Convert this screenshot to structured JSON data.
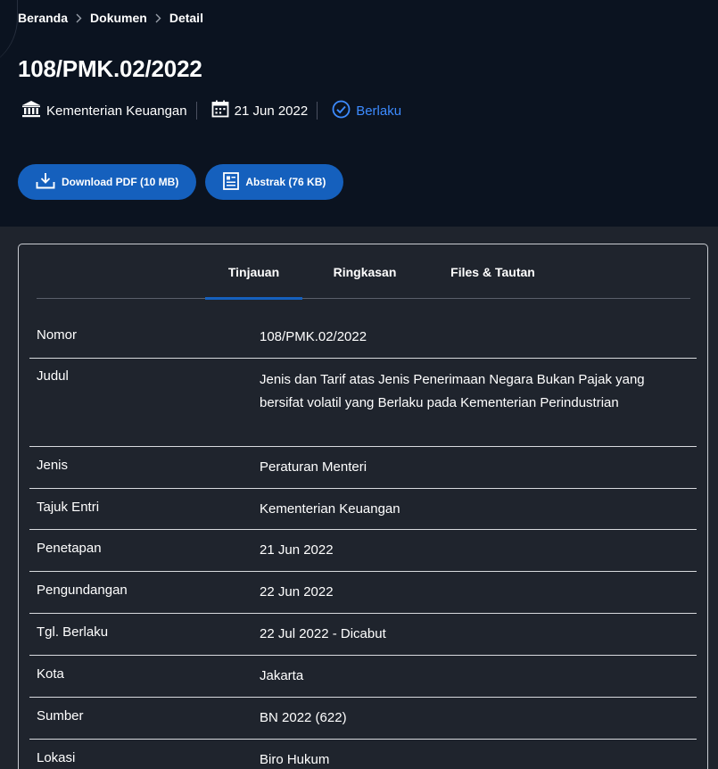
{
  "breadcrumb": [
    "Beranda",
    "Dokumen",
    "Detail"
  ],
  "title": "108/PMK.02/2022",
  "meta": {
    "institution": "Kementerian Keuangan",
    "date": "21 Jun 2022",
    "status": "Berlaku"
  },
  "buttons": {
    "download": "Download PDF (10 MB)",
    "abstract": "Abstrak (76 KB)"
  },
  "tabs": [
    "Tinjauan",
    "Ringkasan",
    "Files & Tautan"
  ],
  "active_tab": "Tinjauan",
  "rows": [
    {
      "label": "Nomor",
      "value": "108/PMK.02/2022"
    },
    {
      "label": "Judul",
      "value": "Jenis dan Tarif atas Jenis Penerimaan Negara Bukan Pajak yang bersifat volatil yang Berlaku pada Kementerian Perindustrian"
    },
    {
      "label": "Jenis",
      "value": "Peraturan Menteri"
    },
    {
      "label": "Tajuk Entri",
      "value": "Kementerian Keuangan"
    },
    {
      "label": "Penetapan",
      "value": "21 Jun 2022"
    },
    {
      "label": "Pengundangan",
      "value": "22 Jun 2022"
    },
    {
      "label": "Tgl. Berlaku",
      "value": "22 Jul 2022 - Dicabut"
    },
    {
      "label": "Kota",
      "value": "Jakarta"
    },
    {
      "label": "Sumber",
      "value": "BN 2022 (622)"
    },
    {
      "label": "Lokasi",
      "value": "Biro Hukum"
    }
  ],
  "colors": {
    "hero_bg": "#0b1320",
    "page_bg": "#1f242d",
    "accent": "#1560bd",
    "status": "#3d8bff"
  },
  "icons": [
    "chevron-right-icon",
    "bank-icon",
    "calendar-icon",
    "check-circle-icon",
    "download-icon",
    "document-icon"
  ]
}
